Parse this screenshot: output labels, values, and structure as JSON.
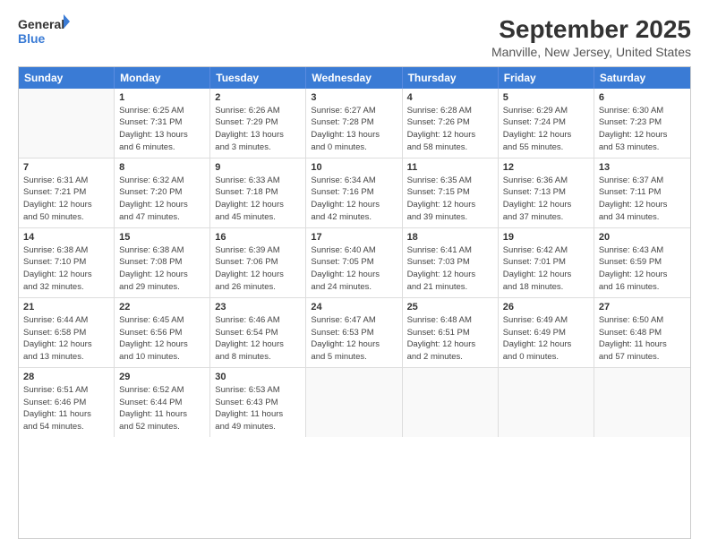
{
  "logo": {
    "text_general": "General",
    "text_blue": "Blue"
  },
  "title": "September 2025",
  "subtitle": "Manville, New Jersey, United States",
  "days_of_week": [
    "Sunday",
    "Monday",
    "Tuesday",
    "Wednesday",
    "Thursday",
    "Friday",
    "Saturday"
  ],
  "weeks": [
    [
      {
        "day": "",
        "info": ""
      },
      {
        "day": "1",
        "info": "Sunrise: 6:25 AM\nSunset: 7:31 PM\nDaylight: 13 hours\nand 6 minutes."
      },
      {
        "day": "2",
        "info": "Sunrise: 6:26 AM\nSunset: 7:29 PM\nDaylight: 13 hours\nand 3 minutes."
      },
      {
        "day": "3",
        "info": "Sunrise: 6:27 AM\nSunset: 7:28 PM\nDaylight: 13 hours\nand 0 minutes."
      },
      {
        "day": "4",
        "info": "Sunrise: 6:28 AM\nSunset: 7:26 PM\nDaylight: 12 hours\nand 58 minutes."
      },
      {
        "day": "5",
        "info": "Sunrise: 6:29 AM\nSunset: 7:24 PM\nDaylight: 12 hours\nand 55 minutes."
      },
      {
        "day": "6",
        "info": "Sunrise: 6:30 AM\nSunset: 7:23 PM\nDaylight: 12 hours\nand 53 minutes."
      }
    ],
    [
      {
        "day": "7",
        "info": "Sunrise: 6:31 AM\nSunset: 7:21 PM\nDaylight: 12 hours\nand 50 minutes."
      },
      {
        "day": "8",
        "info": "Sunrise: 6:32 AM\nSunset: 7:20 PM\nDaylight: 12 hours\nand 47 minutes."
      },
      {
        "day": "9",
        "info": "Sunrise: 6:33 AM\nSunset: 7:18 PM\nDaylight: 12 hours\nand 45 minutes."
      },
      {
        "day": "10",
        "info": "Sunrise: 6:34 AM\nSunset: 7:16 PM\nDaylight: 12 hours\nand 42 minutes."
      },
      {
        "day": "11",
        "info": "Sunrise: 6:35 AM\nSunset: 7:15 PM\nDaylight: 12 hours\nand 39 minutes."
      },
      {
        "day": "12",
        "info": "Sunrise: 6:36 AM\nSunset: 7:13 PM\nDaylight: 12 hours\nand 37 minutes."
      },
      {
        "day": "13",
        "info": "Sunrise: 6:37 AM\nSunset: 7:11 PM\nDaylight: 12 hours\nand 34 minutes."
      }
    ],
    [
      {
        "day": "14",
        "info": "Sunrise: 6:38 AM\nSunset: 7:10 PM\nDaylight: 12 hours\nand 32 minutes."
      },
      {
        "day": "15",
        "info": "Sunrise: 6:38 AM\nSunset: 7:08 PM\nDaylight: 12 hours\nand 29 minutes."
      },
      {
        "day": "16",
        "info": "Sunrise: 6:39 AM\nSunset: 7:06 PM\nDaylight: 12 hours\nand 26 minutes."
      },
      {
        "day": "17",
        "info": "Sunrise: 6:40 AM\nSunset: 7:05 PM\nDaylight: 12 hours\nand 24 minutes."
      },
      {
        "day": "18",
        "info": "Sunrise: 6:41 AM\nSunset: 7:03 PM\nDaylight: 12 hours\nand 21 minutes."
      },
      {
        "day": "19",
        "info": "Sunrise: 6:42 AM\nSunset: 7:01 PM\nDaylight: 12 hours\nand 18 minutes."
      },
      {
        "day": "20",
        "info": "Sunrise: 6:43 AM\nSunset: 6:59 PM\nDaylight: 12 hours\nand 16 minutes."
      }
    ],
    [
      {
        "day": "21",
        "info": "Sunrise: 6:44 AM\nSunset: 6:58 PM\nDaylight: 12 hours\nand 13 minutes."
      },
      {
        "day": "22",
        "info": "Sunrise: 6:45 AM\nSunset: 6:56 PM\nDaylight: 12 hours\nand 10 minutes."
      },
      {
        "day": "23",
        "info": "Sunrise: 6:46 AM\nSunset: 6:54 PM\nDaylight: 12 hours\nand 8 minutes."
      },
      {
        "day": "24",
        "info": "Sunrise: 6:47 AM\nSunset: 6:53 PM\nDaylight: 12 hours\nand 5 minutes."
      },
      {
        "day": "25",
        "info": "Sunrise: 6:48 AM\nSunset: 6:51 PM\nDaylight: 12 hours\nand 2 minutes."
      },
      {
        "day": "26",
        "info": "Sunrise: 6:49 AM\nSunset: 6:49 PM\nDaylight: 12 hours\nand 0 minutes."
      },
      {
        "day": "27",
        "info": "Sunrise: 6:50 AM\nSunset: 6:48 PM\nDaylight: 11 hours\nand 57 minutes."
      }
    ],
    [
      {
        "day": "28",
        "info": "Sunrise: 6:51 AM\nSunset: 6:46 PM\nDaylight: 11 hours\nand 54 minutes."
      },
      {
        "day": "29",
        "info": "Sunrise: 6:52 AM\nSunset: 6:44 PM\nDaylight: 11 hours\nand 52 minutes."
      },
      {
        "day": "30",
        "info": "Sunrise: 6:53 AM\nSunset: 6:43 PM\nDaylight: 11 hours\nand 49 minutes."
      },
      {
        "day": "",
        "info": ""
      },
      {
        "day": "",
        "info": ""
      },
      {
        "day": "",
        "info": ""
      },
      {
        "day": "",
        "info": ""
      }
    ]
  ]
}
